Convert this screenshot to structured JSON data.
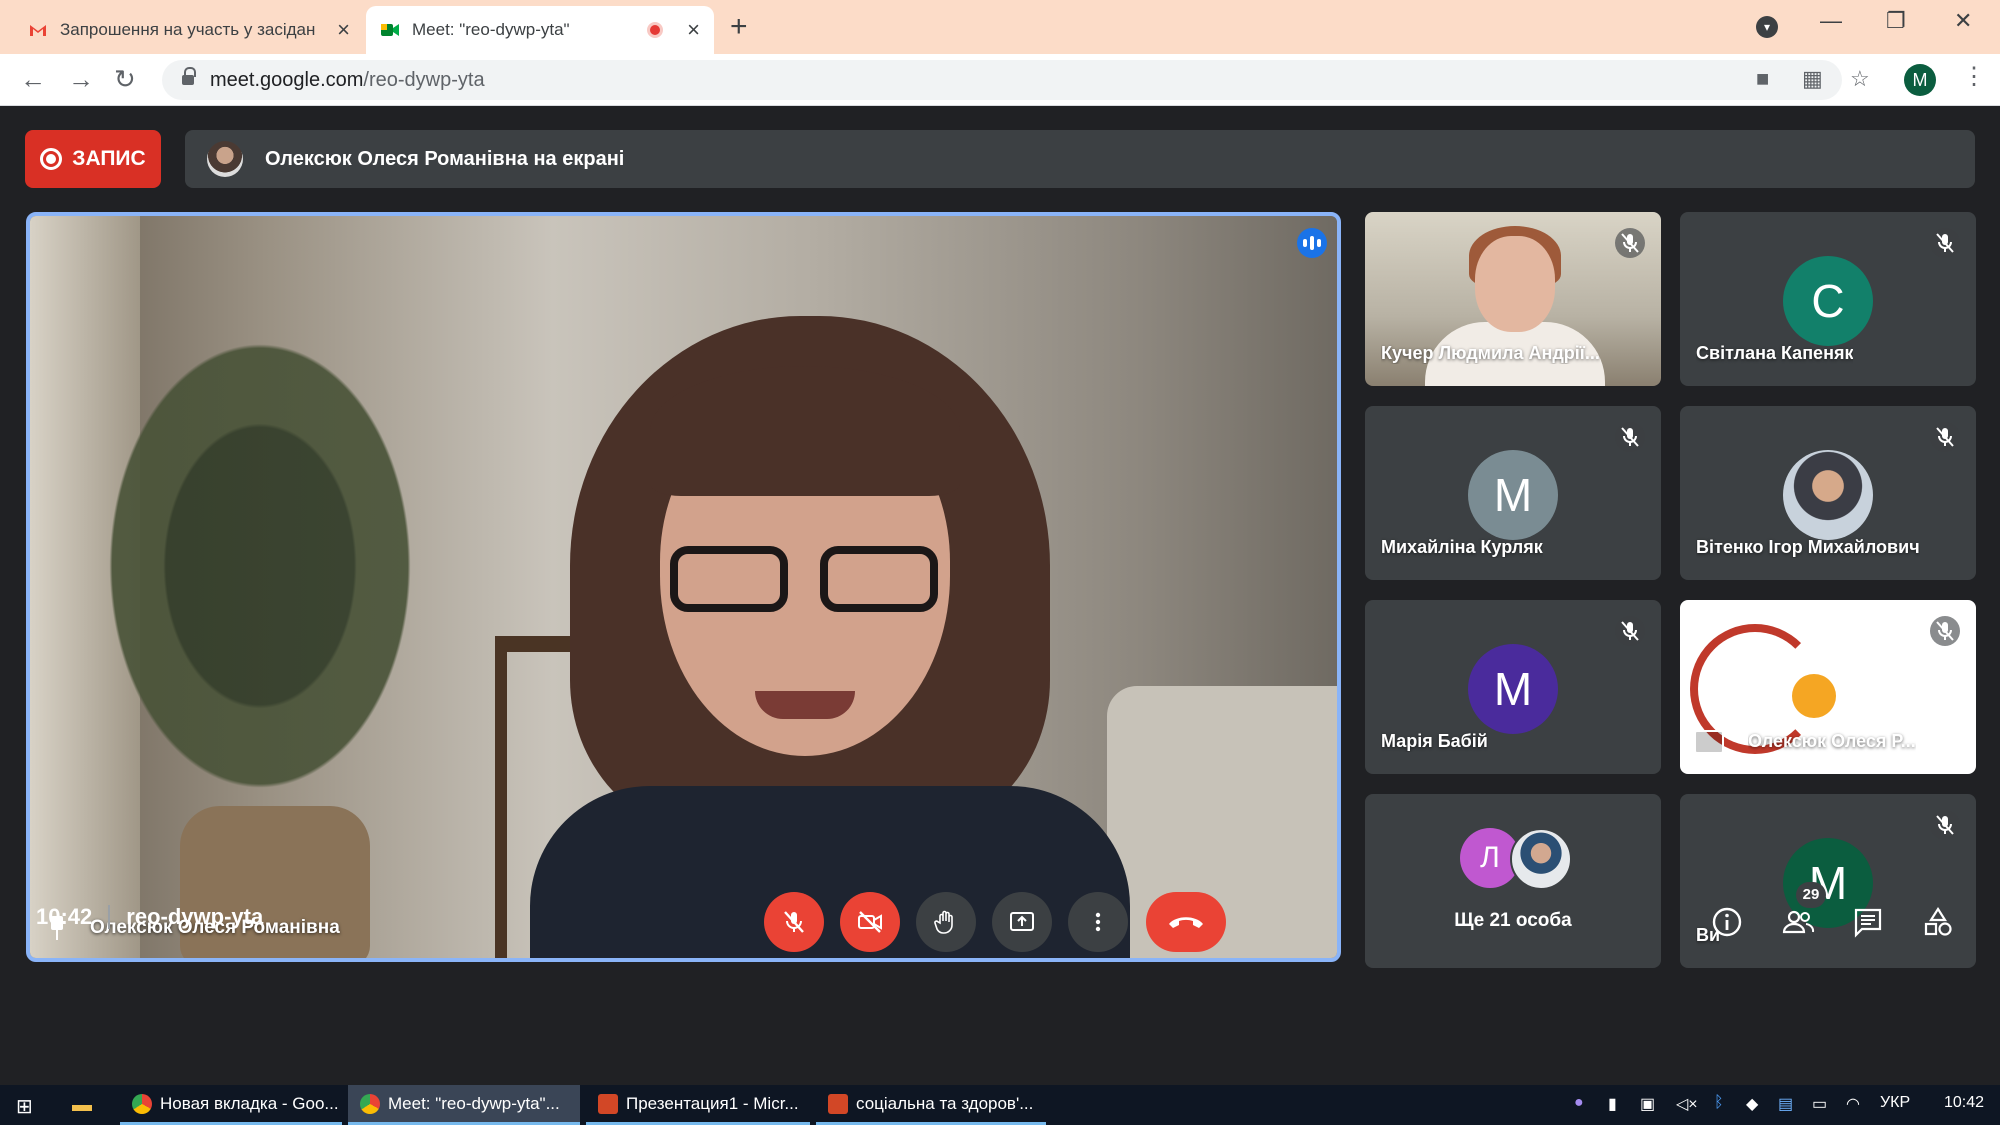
{
  "browser": {
    "tabs": [
      {
        "title": "Запрошення на участь у засідан",
        "active": false
      },
      {
        "title": "Meet: \"reo-dywp-yta\"",
        "active": true
      }
    ],
    "url_host": "meet.google.com",
    "url_path": "/reo-dywp-yta",
    "profile_initial": "M"
  },
  "meet": {
    "record_label": "ЗАПИС",
    "presenting_text": "Олексюк Олеся Романівна на екрані",
    "main_speaker": "Олексюк Олеся Романівна",
    "tiles": [
      {
        "name": "Кучер Людмила Андрії...",
        "type": "video",
        "muted": true
      },
      {
        "name": "Світлана Капеняк",
        "initial": "C",
        "color": "#12806a",
        "muted": true
      },
      {
        "name": "Михайліна Курляк",
        "initial": "M",
        "color": "#7a8c93",
        "muted": true
      },
      {
        "name": "Вітенко Ігор Михайлович",
        "type": "photo",
        "muted": true
      },
      {
        "name": "Марія Бабій",
        "initial": "M",
        "color": "#4a2b9c",
        "muted": true
      },
      {
        "name": "Олексюк Олеся Р...",
        "type": "presentation",
        "muted": true
      },
      {
        "more_initial": "Л",
        "more_label": "Ще 21 особа"
      },
      {
        "name": "Ви",
        "initial": "M",
        "color": "#0b5d3f",
        "muted": true
      }
    ],
    "time": "10:42",
    "meeting_code": "reo-dywp-yta",
    "participants_count": "29"
  },
  "taskbar": {
    "items": [
      {
        "label": "Новая вкладка - Goo...",
        "active": false
      },
      {
        "label": "Meet: \"reo-dywp-yta\"...",
        "active": true
      },
      {
        "label": "Презентация1 - Micr...",
        "active": false
      },
      {
        "label": "соціальна та здоров'...",
        "active": false
      }
    ],
    "language": "УКР",
    "clock": "10:42"
  },
  "colors": {
    "accent": "#1a73e8",
    "danger": "#ea4335",
    "meet_bg": "#202124",
    "tile_bg": "#3c4043"
  }
}
